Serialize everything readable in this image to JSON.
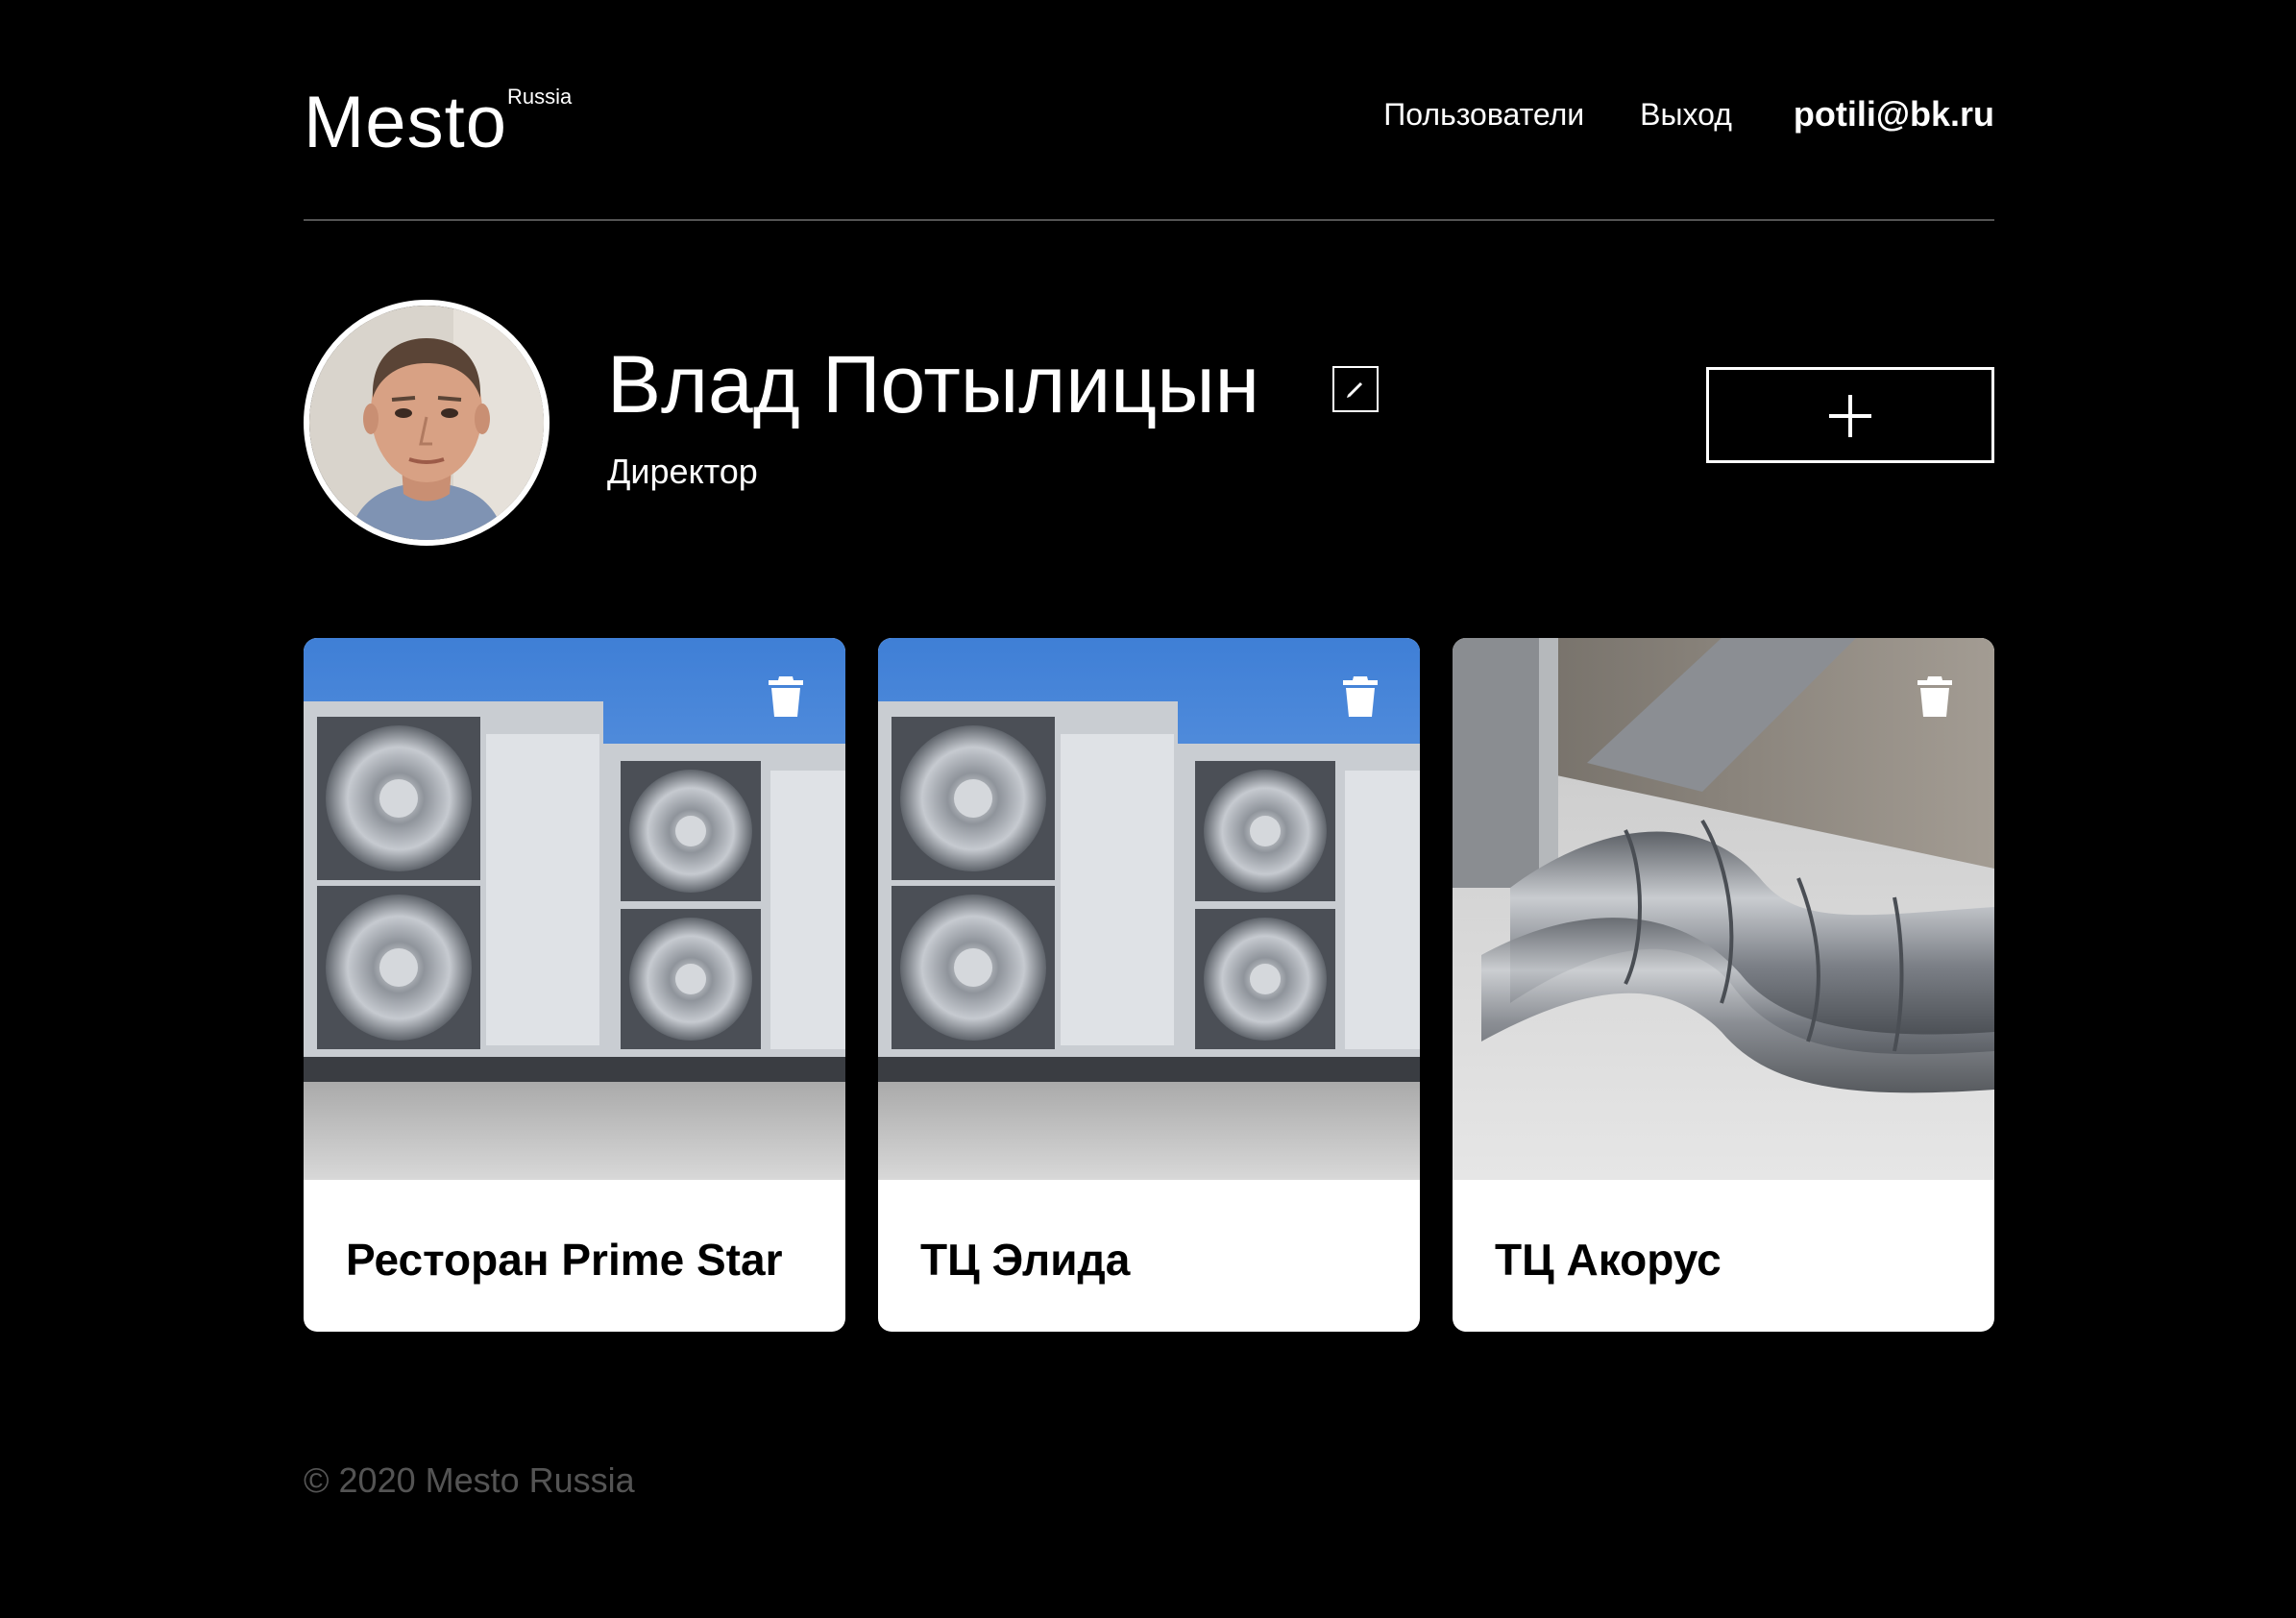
{
  "header": {
    "logo": "Mesto",
    "logo_sub": "Russia",
    "nav": [
      {
        "label": "Пользователи"
      },
      {
        "label": "Выход"
      }
    ],
    "email": "potili@bk.ru"
  },
  "profile": {
    "name": "Влад Потылицын",
    "job": "Директор",
    "icons": {
      "edit": "pencil-icon",
      "add": "plus-icon"
    }
  },
  "cards": [
    {
      "title": "Ресторан Prime Star",
      "image": "outdoor-ac-units",
      "icon": "trash-icon"
    },
    {
      "title": "ТЦ Элида",
      "image": "outdoor-ac-units",
      "icon": "trash-icon"
    },
    {
      "title": "ТЦ Акорус",
      "image": "ventilation-ducts",
      "icon": "trash-icon"
    }
  ],
  "footer": {
    "copyright": "© 2020 Mesto Russia"
  },
  "colors": {
    "background": "#000000",
    "text": "#ffffff",
    "divider": "#545454",
    "footer": "#545454",
    "card": "#ffffff"
  }
}
